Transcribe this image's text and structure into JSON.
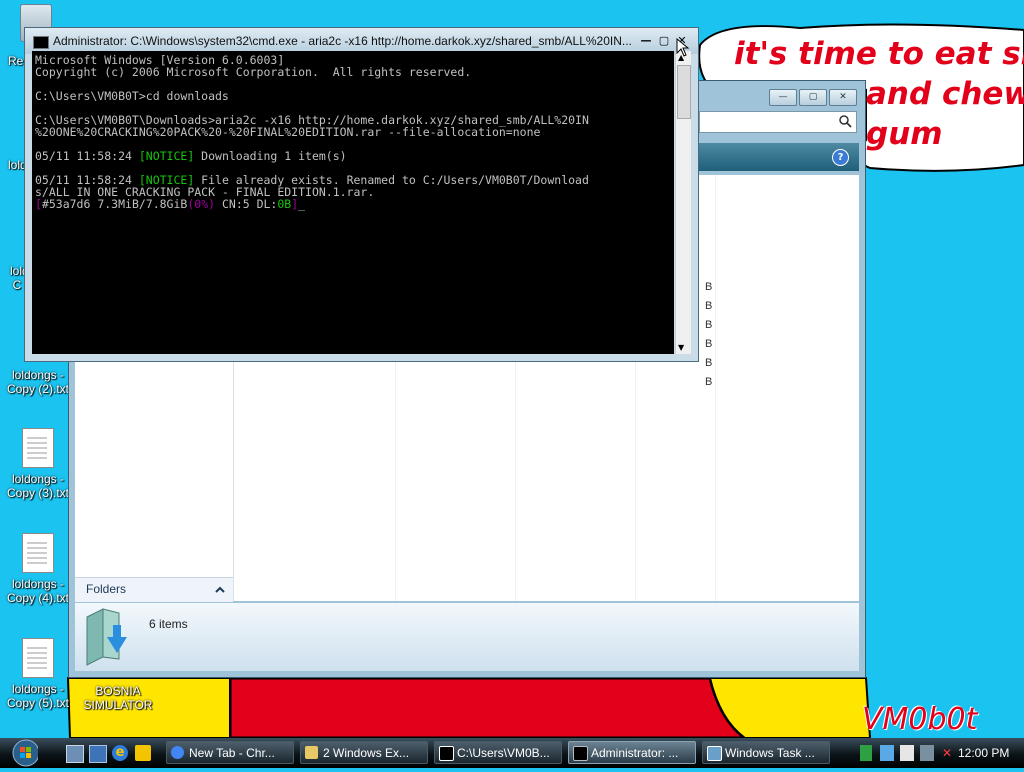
{
  "wallpaper": {
    "caption_line1": "it's time to eat shit",
    "caption_line2": "and chew",
    "caption_line3": "gum",
    "signature": "VM0b0t",
    "colors": {
      "sky": "#1bc3f0",
      "red": "#e2001a",
      "yellow": "#ffe600"
    }
  },
  "desktop_icons": [
    {
      "label": "Re",
      "icon": "recycle-bin-icon"
    },
    {
      "label": "lold",
      "icon": "document-icon"
    },
    {
      "label": "lold C",
      "icon": "document-icon"
    },
    {
      "label": "loldongs - Copy (2).txt",
      "icon": "document-icon"
    },
    {
      "label": "loldongs - Copy (3).txt",
      "icon": "document-icon"
    },
    {
      "label": "loldongs - Copy (4).txt",
      "icon": "document-icon"
    },
    {
      "label": "loldongs - Copy (5).txt",
      "icon": "document-icon"
    },
    {
      "label": "BOSNIA SIMULATOR",
      "icon": "bosnia-simulator-icon"
    }
  ],
  "explorer": {
    "folders_label": "Folders",
    "item_count": "6 items",
    "size_suffix": [
      "B",
      "B",
      "B",
      "B",
      "B",
      "B"
    ],
    "buttons": {
      "minimize": "—",
      "maximize": "▢",
      "close": "✕"
    }
  },
  "cmd": {
    "title": "Administrator: C:\\Windows\\system32\\cmd.exe - aria2c  -x16 http://home.darkok.xyz/shared_smb/ALL%20IN...",
    "lines": {
      "l1": "Microsoft Windows [Version 6.0.6003]",
      "l2": "Copyright (c) 2006 Microsoft Corporation.  All rights reserved.",
      "l3": "C:\\Users\\VM0B0T>cd downloads",
      "l4": "C:\\Users\\VM0B0T\\Downloads>aria2c -x16 http://home.darkok.xyz/shared_smb/ALL%20IN",
      "l5": "%20ONE%20CRACKING%20PACK%20-%20FINAL%20EDITION.rar --file-allocation=none",
      "l6_ts": "05/11 11:58:24 ",
      "l6_tag": "[NOTICE]",
      "l6_rest": " Downloading 1 item(s)",
      "l7_ts": "05/11 11:58:24 ",
      "l7_tag": "[NOTICE]",
      "l7_rest": " File already exists. Renamed to C:/Users/VM0B0T/Download",
      "l8": "s/ALL IN ONE CRACKING PACK - FINAL EDITION.1.rar.",
      "l9_open": "[",
      "l9_gid": "#53a7d6 7.3MiB/7.8GiB",
      "l9_pct": "(0%)",
      "l9_cn": " CN:5 DL:",
      "l9_dl": "0B",
      "l9_close": "]",
      "cursor": "_"
    }
  },
  "taskbar": {
    "buttons": [
      {
        "label": "New Tab - Chr...",
        "icon": "chrome-icon"
      },
      {
        "label": "2 Windows Ex...",
        "icon": "folder-icon"
      },
      {
        "label": "C:\\Users\\VM0B...",
        "icon": "7zip-icon"
      },
      {
        "label": "Administrator: ...",
        "icon": "cmd-icon"
      },
      {
        "label": "Windows Task ...",
        "icon": "task-manager-icon"
      }
    ],
    "clock": "12:00 PM"
  }
}
